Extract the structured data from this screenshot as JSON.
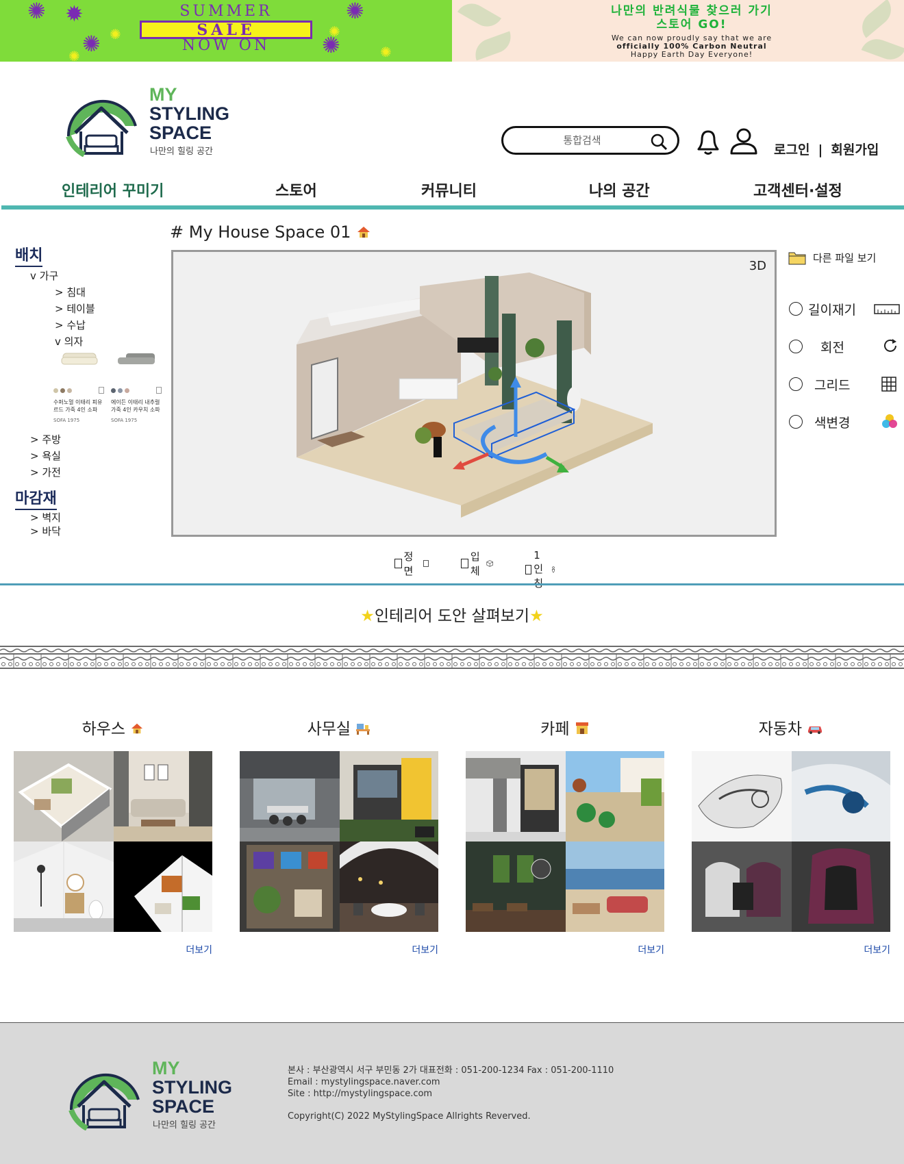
{
  "banner_left": {
    "line1": "SUMMER",
    "line2": "SALE",
    "line3": "NOW ON"
  },
  "banner_right": {
    "title_line1": "나만의 반려식물 찾으러 가기",
    "title_line2": "스토어 GO!",
    "sub_line1": "We can now proudly say that we are",
    "sub_line2": "officially 100% Carbon Neutral",
    "sub_line3": "Happy Earth Day Everyone!"
  },
  "logo": {
    "line1": "MY",
    "line2": "STYLING",
    "line3": "SPACE",
    "tagline": "나만의 힐링 공간",
    "accent_color": "#5fb55a",
    "dark_color": "#1c2a4a"
  },
  "header": {
    "search_placeholder": "통합검색",
    "login": "로그인",
    "separator": "|",
    "signup": "회원가입"
  },
  "nav": {
    "items": [
      {
        "label": "인테리어 꾸미기",
        "active": true
      },
      {
        "label": "스토어"
      },
      {
        "label": "커뮤니티"
      },
      {
        "label": "나의 공간"
      },
      {
        "label": "고객센터·설정"
      }
    ],
    "active_color": "#1f6b4d",
    "line_color": "#4fb7b1"
  },
  "sidebar": {
    "placement": "배치",
    "furniture": "v 가구",
    "bed": "> 침대",
    "table": "> 테이블",
    "storage": "> 수납",
    "chair": "v 의자",
    "sofa1": {
      "desc": "수퍼노멀 이태리 피유 르드 가죽 4인 소파",
      "brand": "SOFA 1975"
    },
    "sofa2": {
      "desc": "에이든 이태리 내추럴 가죽 4인 카우치 소파",
      "brand": "SOFA 1975"
    },
    "kitchen": "> 주방",
    "bath": "> 욕실",
    "appliance": "> 가전",
    "finishing": "마감재",
    "wallpaper": "> 벽지",
    "floor": "> 바닥"
  },
  "workspace": {
    "title": "# My House Space 01",
    "mode": "3D",
    "view_front": "정면",
    "view_3d": "입체",
    "view_first_person": "1인칭"
  },
  "tools": {
    "other_files": "다른 파일 보기",
    "measure": "길이재기",
    "rotate": "회전",
    "grid": "그리드",
    "color": "색변경"
  },
  "ideas": {
    "title": "인테리어 도안 살펴보기",
    "categories": [
      {
        "title": "하우스",
        "more": "더보기"
      },
      {
        "title": "사무실",
        "more": "더보기"
      },
      {
        "title": "카페",
        "more": "더보기"
      },
      {
        "title": "자동차",
        "more": "더보기"
      }
    ]
  },
  "footer": {
    "address": "본사 : 부산광역시 서구 부민동 2가  대표전화 : 051-200-1234 Fax : 051-200-1110",
    "email": "Email : mystylingspace.naver.com",
    "site": "Site : http://mystylingspace.com",
    "copyright": "Copyright(C) 2022 MyStylingSpace Allrights Reverved."
  }
}
